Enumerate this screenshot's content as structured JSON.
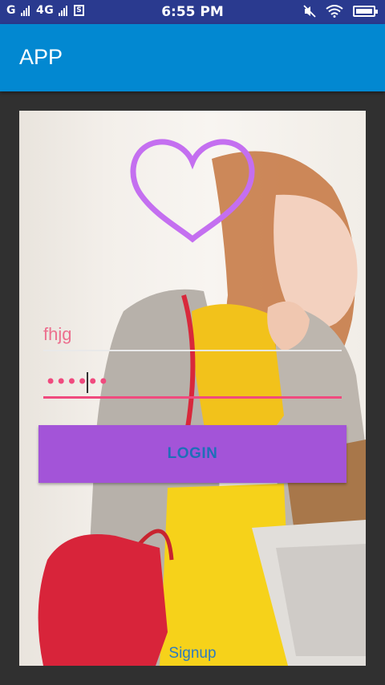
{
  "status_bar": {
    "signal_1": "G",
    "signal_2": "4G",
    "sim_icon_text": "S",
    "time": "6:55 PM",
    "icons": [
      "signal-icon",
      "signal-icon",
      "sim-icon",
      "mute-icon",
      "wifi-icon",
      "battery-icon"
    ]
  },
  "app_bar": {
    "title": "APP"
  },
  "login": {
    "username_value": "fhjg",
    "password_value": "••••••",
    "login_button": "LOGIN",
    "signup_link": "Signup"
  },
  "colors": {
    "status_bar": "#2a3a8f",
    "app_bar": "#0288d1",
    "accent_pink": "#f04a7e",
    "heart": "#c46ff0",
    "button": "#a354d8",
    "button_text": "#1e6fb8"
  }
}
